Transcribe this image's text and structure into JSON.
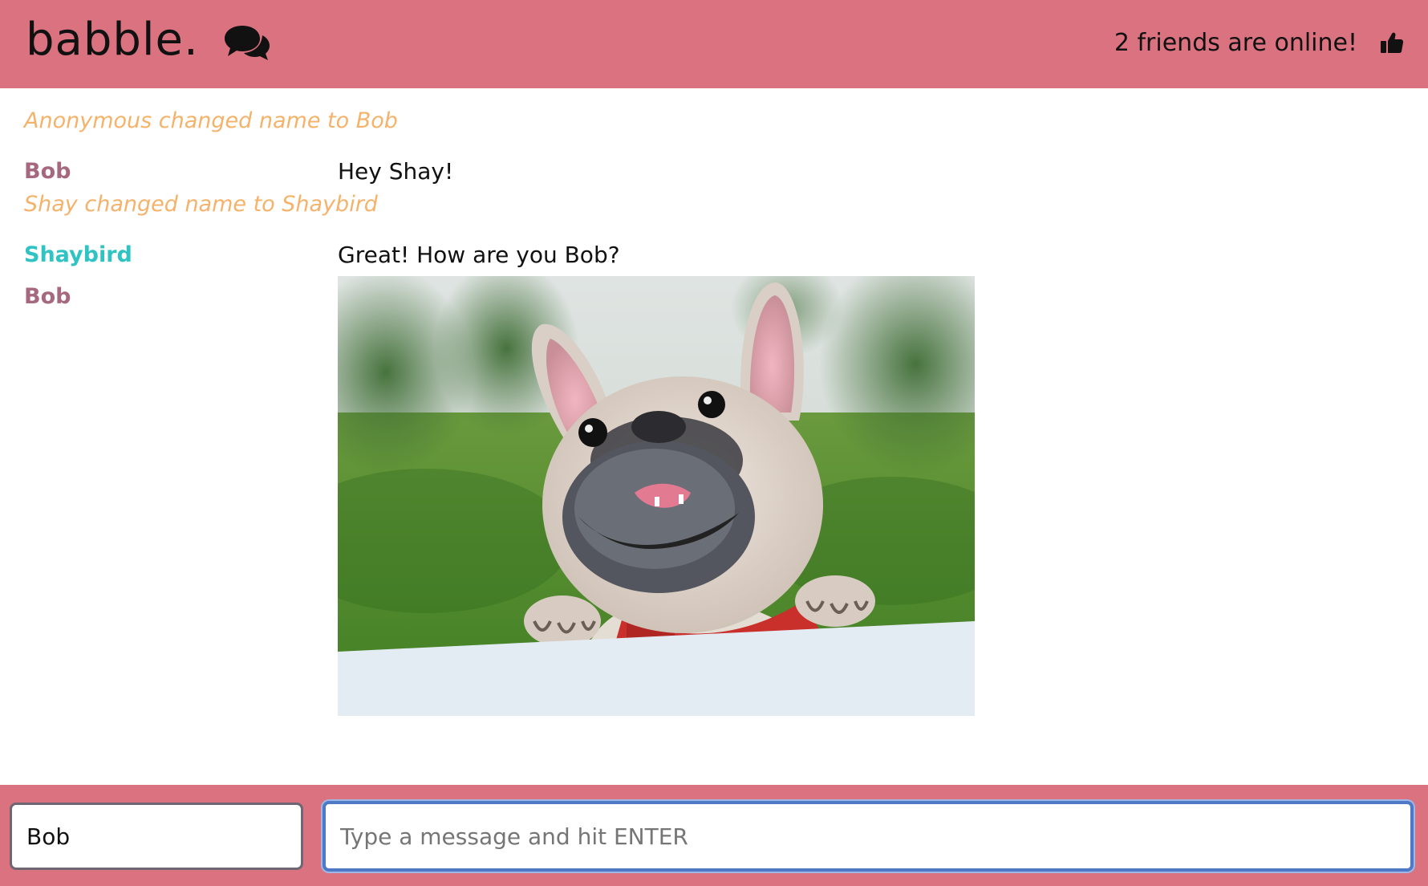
{
  "app": {
    "brand_name": "babble.",
    "brand_icon": "chat-bubbles-icon",
    "online_text": "2 friends are online!",
    "online_icon": "thumbs-up-icon"
  },
  "colors": {
    "header_bg": "#da727f",
    "notification": "#f5b26b",
    "bob": "#a5687f",
    "shaybird": "#30c3c3"
  },
  "messages": [
    {
      "type": "notification",
      "text": "Anonymous changed name to Bob"
    },
    {
      "type": "message",
      "user": "Bob",
      "content": "Hey Shay!"
    },
    {
      "type": "notification",
      "text": "Shay changed name to Shaybird"
    },
    {
      "type": "message",
      "user": "Shaybird",
      "content": "Great! How are you Bob?"
    },
    {
      "type": "image",
      "user": "Bob"
    }
  ],
  "composer": {
    "username_value": "Bob",
    "message_placeholder": "Type a message and hit ENTER"
  }
}
